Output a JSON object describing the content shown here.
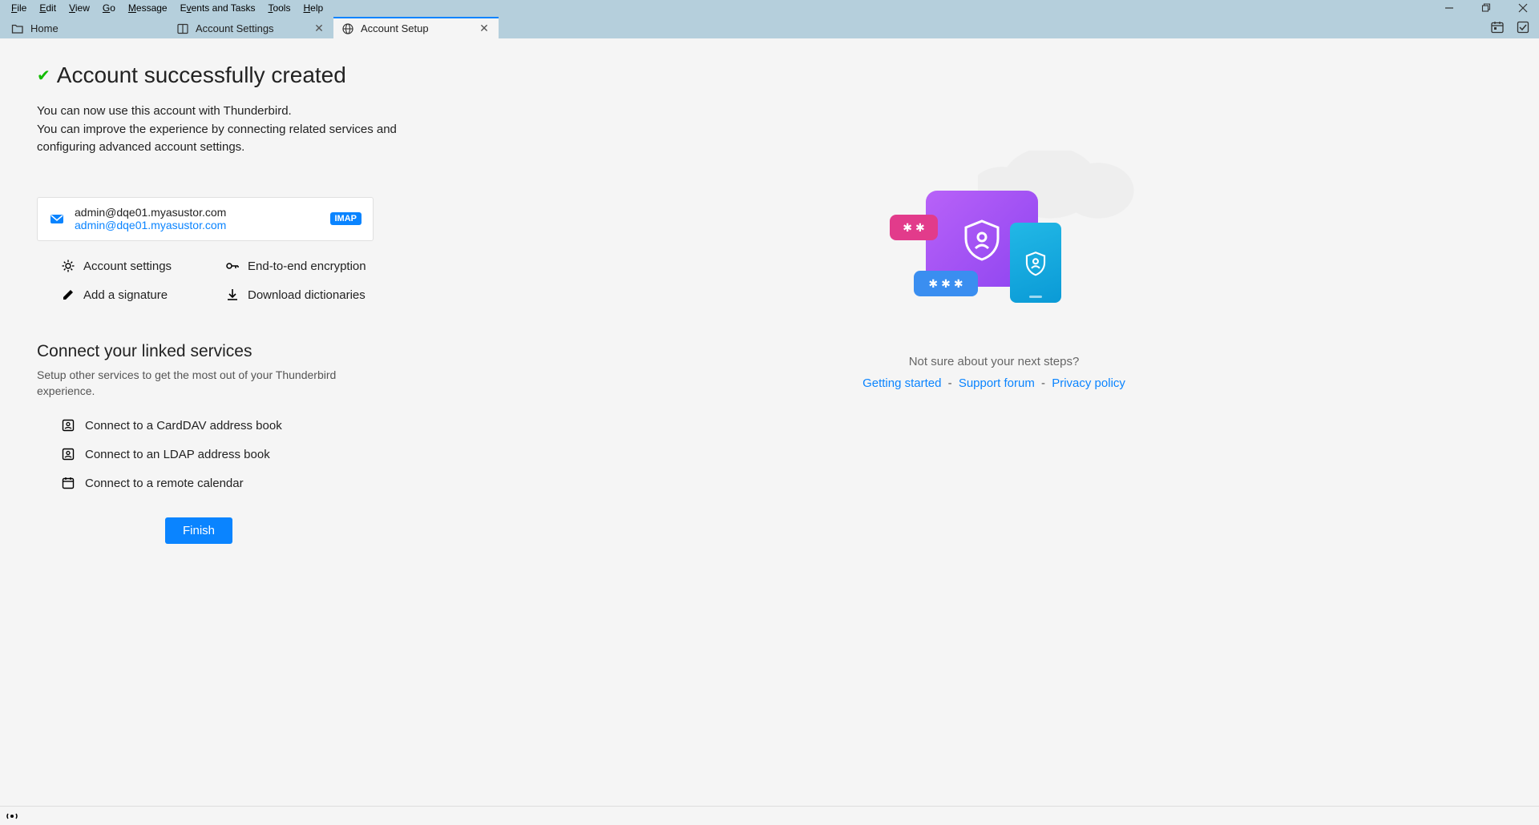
{
  "menu": {
    "items": [
      "File",
      "Edit",
      "View",
      "Go",
      "Message",
      "Events and Tasks",
      "Tools",
      "Help"
    ]
  },
  "tabs": [
    {
      "label": "Home",
      "active": false,
      "closable": false
    },
    {
      "label": "Account Settings",
      "active": false,
      "closable": true
    },
    {
      "label": "Account Setup",
      "active": true,
      "closable": true
    }
  ],
  "page": {
    "title": "Account successfully created",
    "intro_line1": "You can now use this account with Thunderbird.",
    "intro_line2": "You can improve the experience by connecting related services and configuring advanced account settings."
  },
  "account": {
    "name": "admin@dqe01.myasustor.com",
    "email": "admin@dqe01.myasustor.com",
    "protocol": "IMAP"
  },
  "actions": {
    "settings": "Account settings",
    "encryption": "End-to-end encryption",
    "signature": "Add a signature",
    "dictionaries": "Download dictionaries"
  },
  "linked": {
    "title": "Connect your linked services",
    "subtitle": "Setup other services to get the most out of your Thunderbird experience.",
    "carddav": "Connect to a CardDAV address book",
    "ldap": "Connect to an LDAP address book",
    "calendar": "Connect to a remote calendar"
  },
  "finish_label": "Finish",
  "help": {
    "hint": "Not sure about your next steps?",
    "getting_started": "Getting started",
    "support": "Support forum",
    "privacy": "Privacy policy"
  }
}
